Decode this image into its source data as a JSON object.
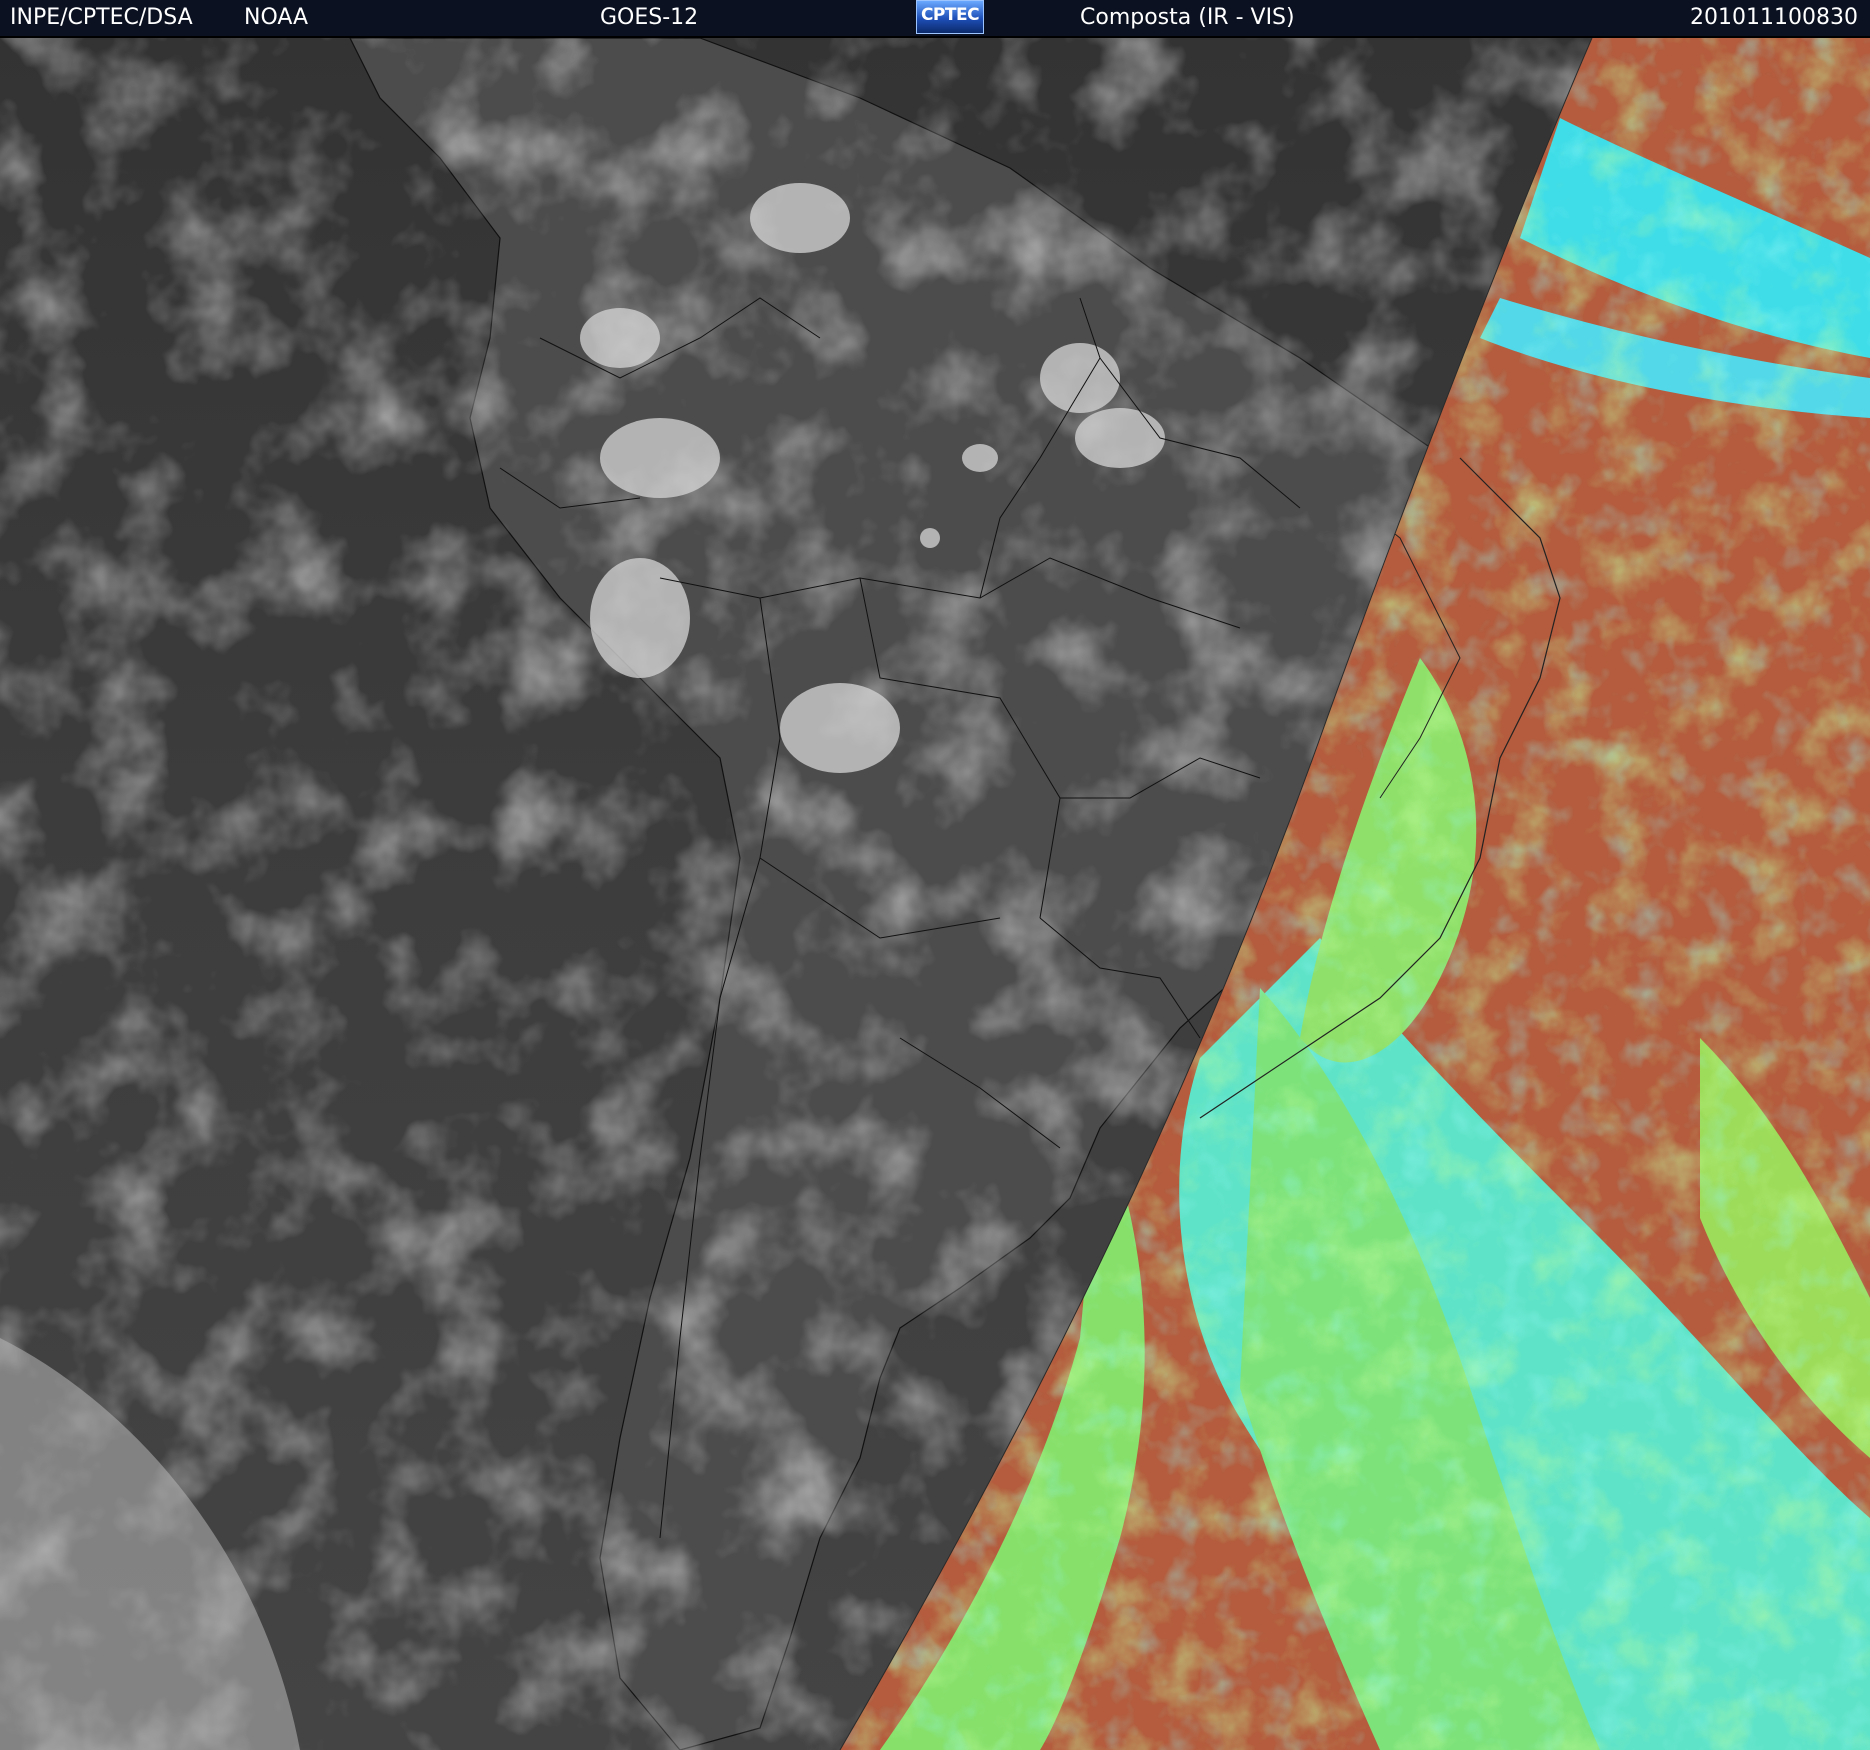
{
  "header": {
    "institution": "INPE/CPTEC/DSA",
    "agency": "NOAA",
    "satellite": "GOES-12",
    "logo_text": "CPTEC",
    "product": "Composta (IR - VIS)",
    "timestamp": "201011100830"
  },
  "colors": {
    "header_bg": "#0b1120",
    "ir_background": "#3c3c3c",
    "ocean_ir": "#383838",
    "land_ir": "#4a4a4a",
    "cloud_ir": "#bdbdbd",
    "vis_red": "#b85a3a",
    "vis_green": "#8ee05a",
    "vis_cyan": "#4fe8d8",
    "border_line": "#000000"
  }
}
